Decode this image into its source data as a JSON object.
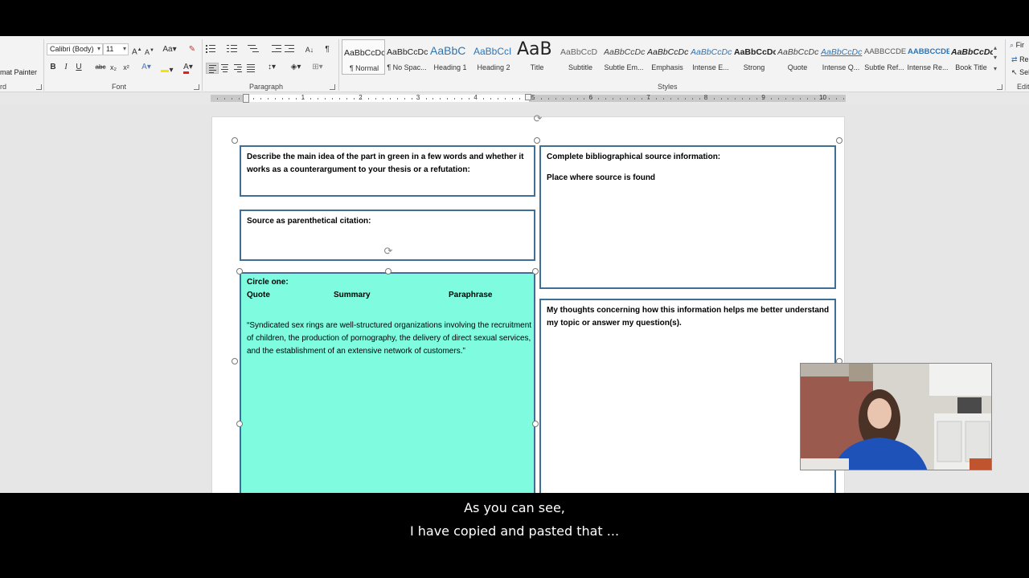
{
  "ribbon": {
    "clipboard": {
      "format_painter": "mat Painter",
      "label": "rd"
    },
    "font": {
      "name": "Calibri (Body)",
      "size": "11",
      "label": "Font",
      "bold": "B",
      "italic": "I",
      "underline": "U",
      "strikethrough": "abc",
      "subscript": "x₂",
      "superscript": "x²",
      "grow": "A",
      "shrink": "A",
      "change_case": "Aa",
      "text_effects": "A",
      "font_color": "A"
    },
    "paragraph": {
      "label": "Paragraph",
      "pilcrow": "¶",
      "sort": "A↓"
    },
    "styles": {
      "label": "Styles",
      "items": [
        {
          "preview": "AaBbCcDc",
          "name": "¶ Normal"
        },
        {
          "preview": "AaBbCcDc",
          "name": "¶ No Spac..."
        },
        {
          "preview": "AaBbC",
          "name": "Heading 1"
        },
        {
          "preview": "AaBbCcI",
          "name": "Heading 2"
        },
        {
          "preview": "AaB",
          "name": "Title"
        },
        {
          "preview": "AaBbCcD",
          "name": "Subtitle"
        },
        {
          "preview": "AaBbCcDc",
          "name": "Subtle Em..."
        },
        {
          "preview": "AaBbCcDc",
          "name": "Emphasis"
        },
        {
          "preview": "AaBbCcDc",
          "name": "Intense E..."
        },
        {
          "preview": "AaBbCcDc",
          "name": "Strong"
        },
        {
          "preview": "AaBbCcDc",
          "name": "Quote"
        },
        {
          "preview": "AaBbCcDc",
          "name": "Intense Q..."
        },
        {
          "preview": "AABBCCDE",
          "name": "Subtle Ref..."
        },
        {
          "preview": "AABBCCDE",
          "name": "Intense Re..."
        },
        {
          "preview": "AaBbCcDc",
          "name": "Book Title"
        }
      ]
    },
    "editing": {
      "find": "Fir",
      "replace": "Re",
      "select": "Sel",
      "label": "Edit"
    }
  },
  "ruler": {
    "numbers": [
      "1",
      "2",
      "3",
      "4",
      "5",
      "6",
      "7",
      "8",
      "9",
      "10"
    ]
  },
  "document": {
    "main_idea_box": "Describe the main idea of the part in green in a few words and whether it works as a counterargument to your thesis or a refutation:",
    "citation_box": "Source as parenthetical citation:",
    "circle_one": "Circle one:",
    "options": [
      "Quote",
      "Summary",
      "Paraphrase"
    ],
    "quote_text": "“Syndicated sex rings are well-structured organizations involving the recruitment of children, the production of pornography, the delivery of direct sexual services, and the establishment of an extensive network of customers.”",
    "bib_title": "Complete bibliographical source information:",
    "bib_place": "Place where source is found",
    "thoughts": "My thoughts concerning how this information helps me better understand my topic or answer my question(s)."
  },
  "colors": {
    "highlight_box": "#7ffbe0",
    "box_border": "#3f6e97",
    "ribbon_bg": "#f3f3f3"
  },
  "captions": {
    "line1": "As you can see,",
    "line2": "I have copied and pasted that ..."
  }
}
